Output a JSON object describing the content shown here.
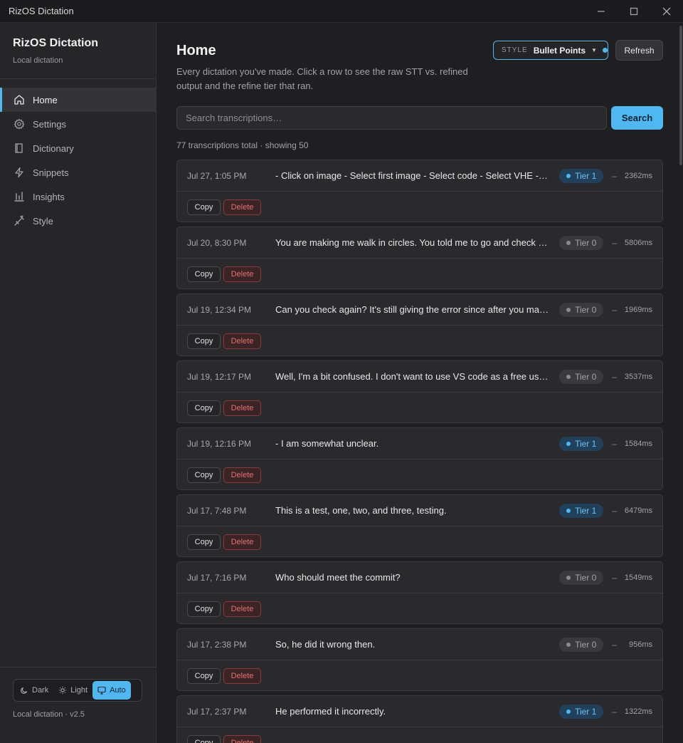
{
  "window": {
    "title": "RizOS Dictation"
  },
  "sidebar": {
    "brand_name": "RizOS Dictation",
    "brand_sub": "Local dictation",
    "items": [
      {
        "label": "Home",
        "icon": "home-icon",
        "active": true
      },
      {
        "label": "Settings",
        "icon": "gear-icon",
        "active": false
      },
      {
        "label": "Dictionary",
        "icon": "book-icon",
        "active": false
      },
      {
        "label": "Snippets",
        "icon": "lightning-icon",
        "active": false
      },
      {
        "label": "Insights",
        "icon": "bar-chart-icon",
        "active": false
      },
      {
        "label": "Style",
        "icon": "wand-icon",
        "active": false
      }
    ],
    "theme": {
      "dark": "Dark",
      "light": "Light",
      "auto": "Auto",
      "selected": "Auto"
    },
    "version": "Local dictation · v2.5"
  },
  "header": {
    "title": "Home",
    "description": "Every dictation you've made. Click a row to see the raw STT vs. refined output and the refine tier that ran.",
    "style_label": "STYLE",
    "style_value": "Bullet Points",
    "refresh_label": "Refresh"
  },
  "search": {
    "placeholder": "Search transcriptions…",
    "button_label": "Search"
  },
  "count_text": "77 transcriptions total · showing 50",
  "row_actions": {
    "copy": "Copy",
    "delete": "Delete"
  },
  "rows": [
    {
      "date": "Jul 27, 1:05 PM",
      "text": "- Click on image - Select first image - Select code - Select VHE - Submit",
      "tier": "Tier 1",
      "tier_level": 1,
      "duration": "2362ms"
    },
    {
      "date": "Jul 20, 8:30 PM",
      "text": "You are making me walk in circles. You told me to go and check the settings",
      "tier": "Tier 0",
      "tier_level": 0,
      "duration": "5806ms"
    },
    {
      "date": "Jul 19, 12:34 PM",
      "text": "Can you check again? It's still giving the error since after you made the change",
      "tier": "Tier 0",
      "tier_level": 0,
      "duration": "1969ms"
    },
    {
      "date": "Jul 19, 12:17 PM",
      "text": "Well, I'm a bit confused. I don't want to use VS code as a free user, so",
      "tier": "Tier 0",
      "tier_level": 0,
      "duration": "3537ms"
    },
    {
      "date": "Jul 19, 12:16 PM",
      "text": "- I am somewhat unclear.",
      "tier": "Tier 1",
      "tier_level": 1,
      "duration": "1584ms"
    },
    {
      "date": "Jul 17, 7:48 PM",
      "text": "This is a test, one, two, and three, testing.",
      "tier": "Tier 1",
      "tier_level": 1,
      "duration": "6479ms"
    },
    {
      "date": "Jul 17, 7:16 PM",
      "text": "Who should meet the commit?",
      "tier": "Tier 0",
      "tier_level": 0,
      "duration": "1549ms"
    },
    {
      "date": "Jul 17, 2:38 PM",
      "text": "So, he did it wrong then.",
      "tier": "Tier 0",
      "tier_level": 0,
      "duration": "956ms"
    },
    {
      "date": "Jul 17, 2:37 PM",
      "text": "He performed it incorrectly.",
      "tier": "Tier 1",
      "tier_level": 1,
      "duration": "1322ms"
    }
  ],
  "colors": {
    "accent": "#4fb8f0",
    "background": "#1f1f21",
    "sidebar": "#262628",
    "danger": "#e7706e"
  }
}
